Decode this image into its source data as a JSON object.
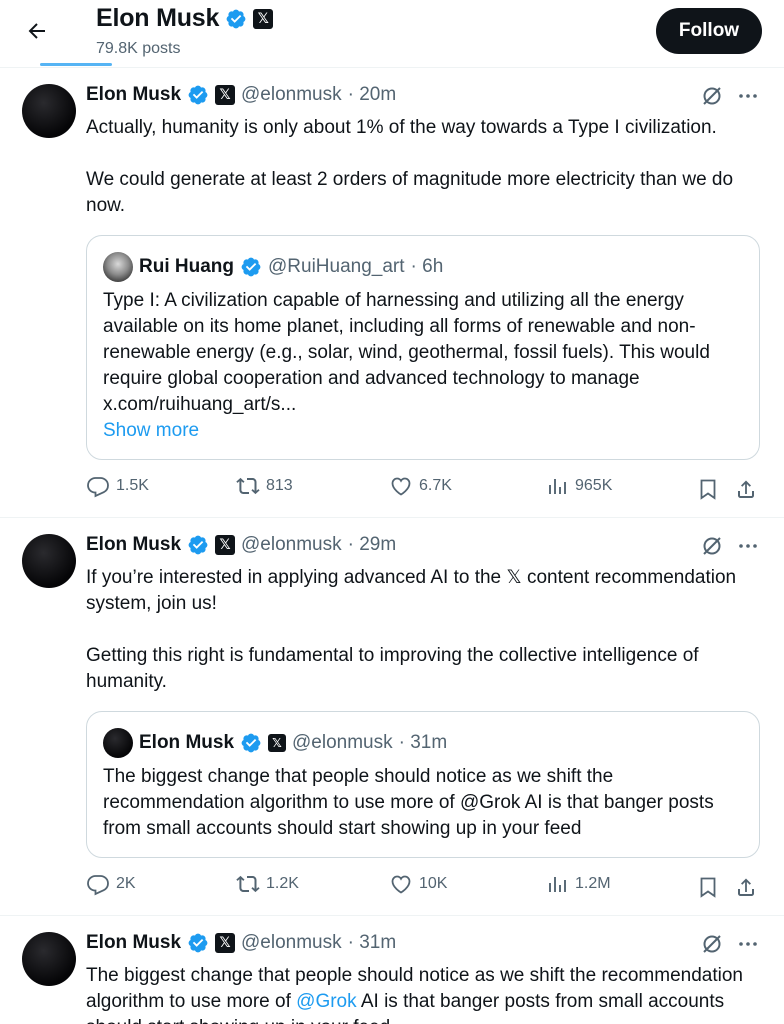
{
  "header": {
    "name": "Elon Musk",
    "posts": "79.8K posts",
    "follow_label": "Follow"
  },
  "icons": {
    "back": "arrow-left-icon",
    "verified": "verified-badge-icon",
    "x_affiliation": "x-logo-icon",
    "grok": "grok-icon",
    "more": "more-icon",
    "reply": "reply-icon",
    "repost": "repost-icon",
    "like": "like-icon",
    "views": "views-icon",
    "bookmark": "bookmark-icon",
    "share": "share-icon"
  },
  "colors": {
    "accent": "#1d9bf0",
    "text": "#0f1419",
    "muted": "#536471"
  },
  "tweets": [
    {
      "name": "Elon Musk",
      "handle": "@elonmusk",
      "time": "· 20m",
      "text1": "Actually, humanity is only about 1% of the way towards a Type I civilization.",
      "text2": "We could generate at least 2 orders of magnitude more electricity than we do now.",
      "quote": {
        "name": "Rui Huang",
        "handle": "@RuiHuang_art",
        "time": "· 6h",
        "text": "Type I: A civilization capable of harnessing and utilizing all the energy available on its home planet, including all forms of renewable and non-renewable energy (e.g., solar, wind, geothermal, fossil fuels). This would require global cooperation and advanced technology to manage x.com/ruihuang_art/s...",
        "show_more": "Show more"
      },
      "stats": {
        "replies": "1.5K",
        "reposts": "813",
        "likes": "6.7K",
        "views": "965K"
      }
    },
    {
      "name": "Elon Musk",
      "handle": "@elonmusk",
      "time": "· 29m",
      "text1": "If you’re interested in applying advanced AI to the 𝕏 content recommendation system, join us!",
      "text2": "Getting this right is fundamental to improving the collective intelligence of humanity.",
      "quote": {
        "name": "Elon Musk",
        "handle": "@elonmusk",
        "time": "· 31m",
        "text": "The biggest change that people should notice as we shift the recommendation algorithm to use more of @Grok AI is that banger posts from small accounts should start showing up in your feed"
      },
      "stats": {
        "replies": "2K",
        "reposts": "1.2K",
        "likes": "10K",
        "views": "1.2M"
      }
    },
    {
      "name": "Elon Musk",
      "handle": "@elonmusk",
      "time": "· 31m",
      "text_before": "The biggest change that people should notice as we shift the recommendation algorithm to use more of ",
      "mention": "@Grok",
      "text_after": " AI is that banger posts from small accounts should start showing up in your feed"
    }
  ]
}
